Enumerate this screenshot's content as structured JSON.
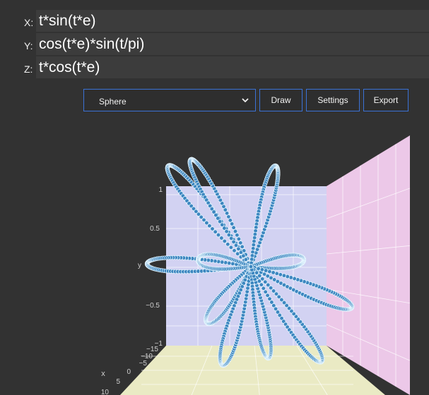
{
  "equations": [
    {
      "axis": "X:",
      "expr": "t*sin(t*e)"
    },
    {
      "axis": "Y:",
      "expr": "cos(t*e)*sin(t/pi)"
    },
    {
      "axis": "Z:",
      "expr": "t*cos(t*e)"
    }
  ],
  "toolbar": {
    "shape_selected": "Sphere",
    "draw_label": "Draw",
    "settings_label": "Settings",
    "export_label": "Export"
  },
  "plot": {
    "y_ticks": [
      "1",
      "0.5",
      "y",
      "−0.5",
      "−1"
    ],
    "x_title": "x",
    "x_ticks": [
      "−15",
      "−10",
      "−5",
      "0",
      "5",
      "10"
    ],
    "colors": {
      "back_wall": "#d2d2f2",
      "side_wall": "#ecc8e8",
      "floor": "#eaeac4",
      "marker": "#3d87c0",
      "marker_edge": "#e8f7ff"
    }
  }
}
